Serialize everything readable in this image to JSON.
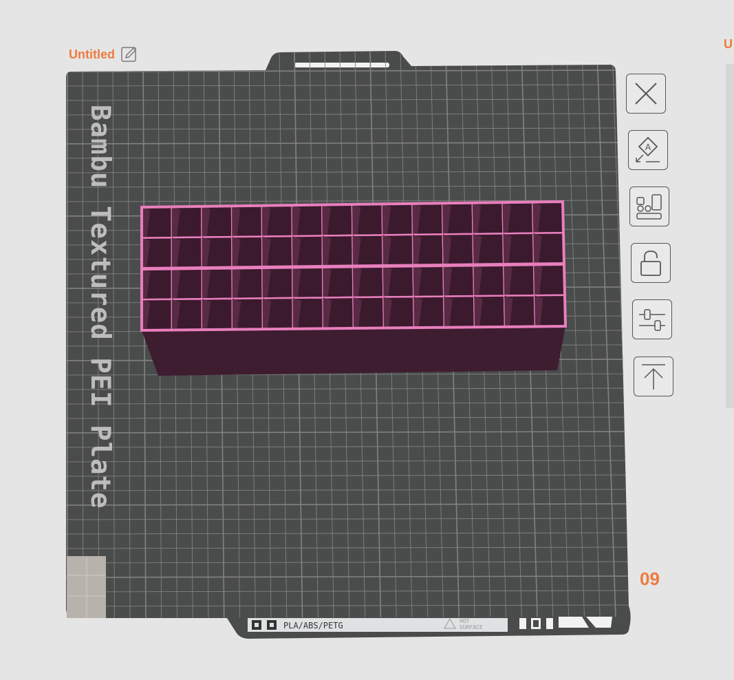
{
  "plate": {
    "title": "Untitled",
    "next_title": "U",
    "bed_label": "Bambu Textured PEI Plate",
    "number": "09",
    "footer": {
      "material_label": "PLA/ABS/PETG",
      "warning_line1": "HOT",
      "warning_line2": "SURFACE"
    }
  },
  "model": {
    "rows": 4,
    "cols": 14,
    "color": "#e87fbd"
  },
  "toolbar": [
    {
      "name": "delete-plate-button",
      "icon": "close-icon"
    },
    {
      "name": "auto-orient-button",
      "icon": "orient-icon"
    },
    {
      "name": "arrange-button",
      "icon": "arrange-icon"
    },
    {
      "name": "lock-button",
      "icon": "lock-icon"
    },
    {
      "name": "plate-settings-button",
      "icon": "sliders-icon"
    },
    {
      "name": "move-to-top-button",
      "icon": "arrow-up-icon"
    }
  ],
  "colors": {
    "accent": "#ee7b3e",
    "bed": "#4a4a4a",
    "grid": "#828282",
    "model_dark": "#3e1d30"
  }
}
